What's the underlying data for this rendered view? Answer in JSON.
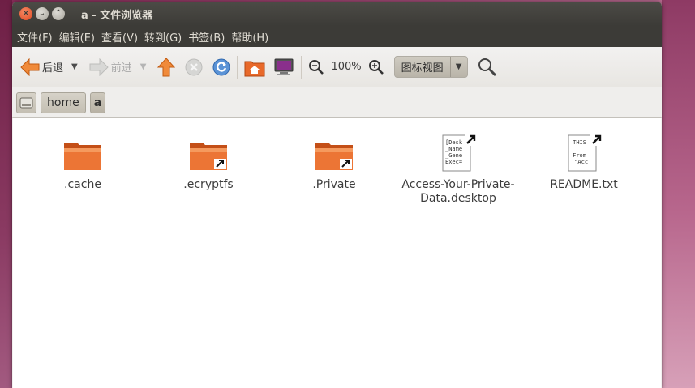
{
  "window": {
    "title": "a - 文件浏览器",
    "buttons": {
      "close": "×",
      "minimize": "⌄",
      "maximize": "⌃"
    }
  },
  "menubar": {
    "items": [
      {
        "label": "文件(F)"
      },
      {
        "label": "编辑(E)"
      },
      {
        "label": "查看(V)"
      },
      {
        "label": "转到(G)"
      },
      {
        "label": "书签(B)"
      },
      {
        "label": "帮助(H)"
      }
    ]
  },
  "toolbar": {
    "back_label": "后退",
    "forward_label": "前进",
    "zoom_percent": "100%",
    "view_mode": "图标视图",
    "dropdown_glyph": "▼",
    "icons": [
      "back-arrow-icon",
      "forward-arrow-icon",
      "up-arrow-icon",
      "stop-icon",
      "reload-icon",
      "home-folder-icon",
      "computer-icon",
      "zoom-out-icon",
      "zoom-in-icon",
      "search-icon"
    ]
  },
  "pathbar": {
    "crumbs": [
      {
        "label": "home"
      },
      {
        "label": "a"
      }
    ]
  },
  "files": [
    {
      "name": ".cache",
      "type": "folder",
      "link": false
    },
    {
      "name": ".ecryptfs",
      "type": "folder",
      "link": true
    },
    {
      "name": ".Private",
      "type": "folder",
      "link": true
    },
    {
      "name": "Access-Your-Private-Data.desktop",
      "name_line1": "Access-Your-Private-",
      "name_line2": "Data.desktop",
      "type": "text",
      "link": true,
      "preview": "[Desk\n_Name\n_Gene\nExec="
    },
    {
      "name": "README.txt",
      "type": "text",
      "link": true,
      "preview": "THIS\n\nFrom\n \"Acc"
    }
  ],
  "colors": {
    "folder_orange": "#e8692a",
    "titlebar": "#3c3b37",
    "close_button": "#e0461f"
  }
}
